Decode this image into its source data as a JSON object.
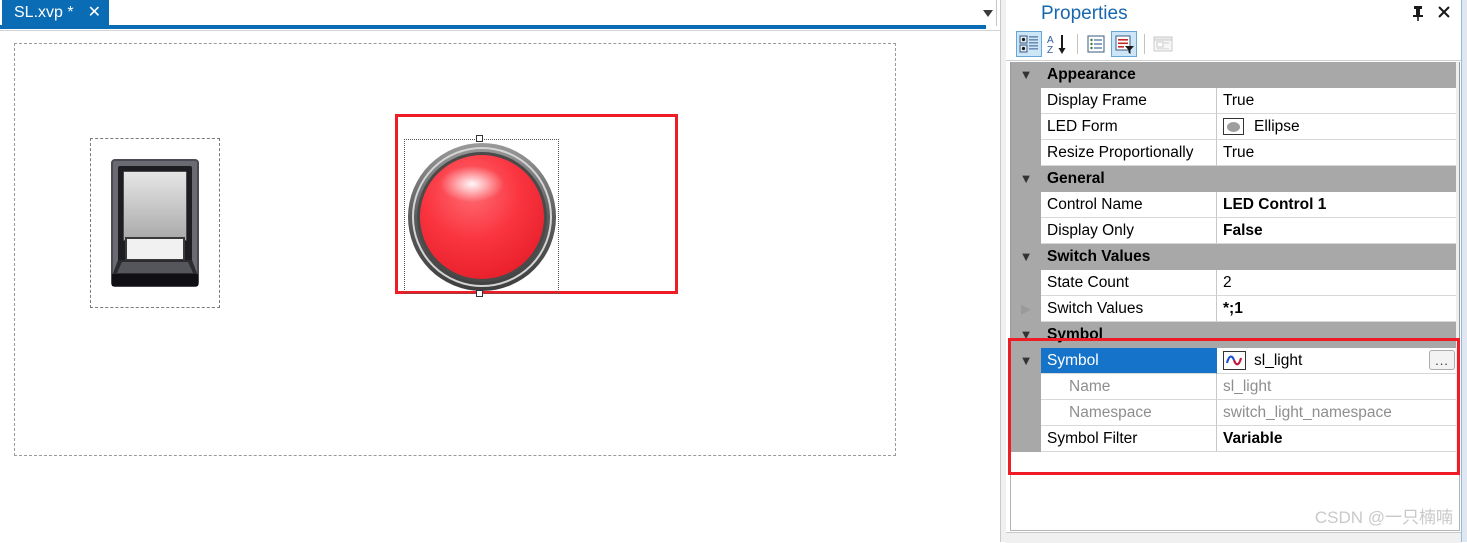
{
  "editor": {
    "tab": {
      "label": "SL.xvp *",
      "close_icon": "close-icon"
    },
    "tab_list_icon": "chevron-down-icon",
    "canvas": {
      "switch_control": {
        "name": "switch-graphic",
        "icon": "rocker-switch-icon"
      },
      "led_control": {
        "name": "led-graphic",
        "icon": "red-led-sphere-icon",
        "color": "#f5333f"
      },
      "annotation_color": "#ee1c25"
    }
  },
  "properties": {
    "title": "Properties",
    "pin_icon": "pushpin-icon",
    "close_icon": "close-icon",
    "toolbar": [
      {
        "name": "categorized-view-button",
        "icon": "categorized-icon",
        "selected": true
      },
      {
        "name": "alphabetical-sort-button",
        "icon": "sort-az-icon",
        "selected": false
      },
      {
        "name": "property-pages-button",
        "icon": "property-pages-icon",
        "selected": false
      },
      {
        "name": "events-filter-button",
        "icon": "filtered-list-icon",
        "selected": true
      },
      {
        "name": "page-properties-button",
        "icon": "page-icon",
        "selected": false,
        "disabled": true
      }
    ],
    "categories": [
      {
        "name": "Appearance",
        "expanded": true,
        "rows": [
          {
            "name": "Display Frame",
            "value": "True",
            "bold": false
          },
          {
            "name": "LED Form",
            "value": "Ellipse",
            "bold": false,
            "swatch": "ellipse-swatch"
          },
          {
            "name": "Resize Proportionally",
            "value": "True",
            "bold": false
          }
        ]
      },
      {
        "name": "General",
        "expanded": true,
        "rows": [
          {
            "name": "Control Name",
            "value": "LED Control 1",
            "bold": true
          },
          {
            "name": "Display Only",
            "value": "False",
            "bold": true
          }
        ]
      },
      {
        "name": "Switch Values",
        "expanded": true,
        "rows": [
          {
            "name": "State Count",
            "value": "2",
            "bold": false
          },
          {
            "name": "Switch Values",
            "value": "*;1",
            "bold": true,
            "expander": "collapsed"
          }
        ]
      },
      {
        "name": "Symbol",
        "expanded": true,
        "rows": [
          {
            "name": "Symbol",
            "value": "sl_light",
            "bold": false,
            "selected": true,
            "expander": "expanded",
            "icon": "waveform-icon",
            "browse_label": "..."
          },
          {
            "name": "Name",
            "value": "sl_light",
            "bold": false,
            "readonly": true,
            "indent": true
          },
          {
            "name": "Namespace",
            "value": "switch_light_namespace",
            "bold": false,
            "readonly": true,
            "indent": true
          },
          {
            "name": "Symbol Filter",
            "value": "Variable",
            "bold": true
          }
        ]
      }
    ],
    "watermark": "CSDN @一只楠喃",
    "highlight_color": "#ee1c25",
    "selection_color": "#1573c9"
  }
}
